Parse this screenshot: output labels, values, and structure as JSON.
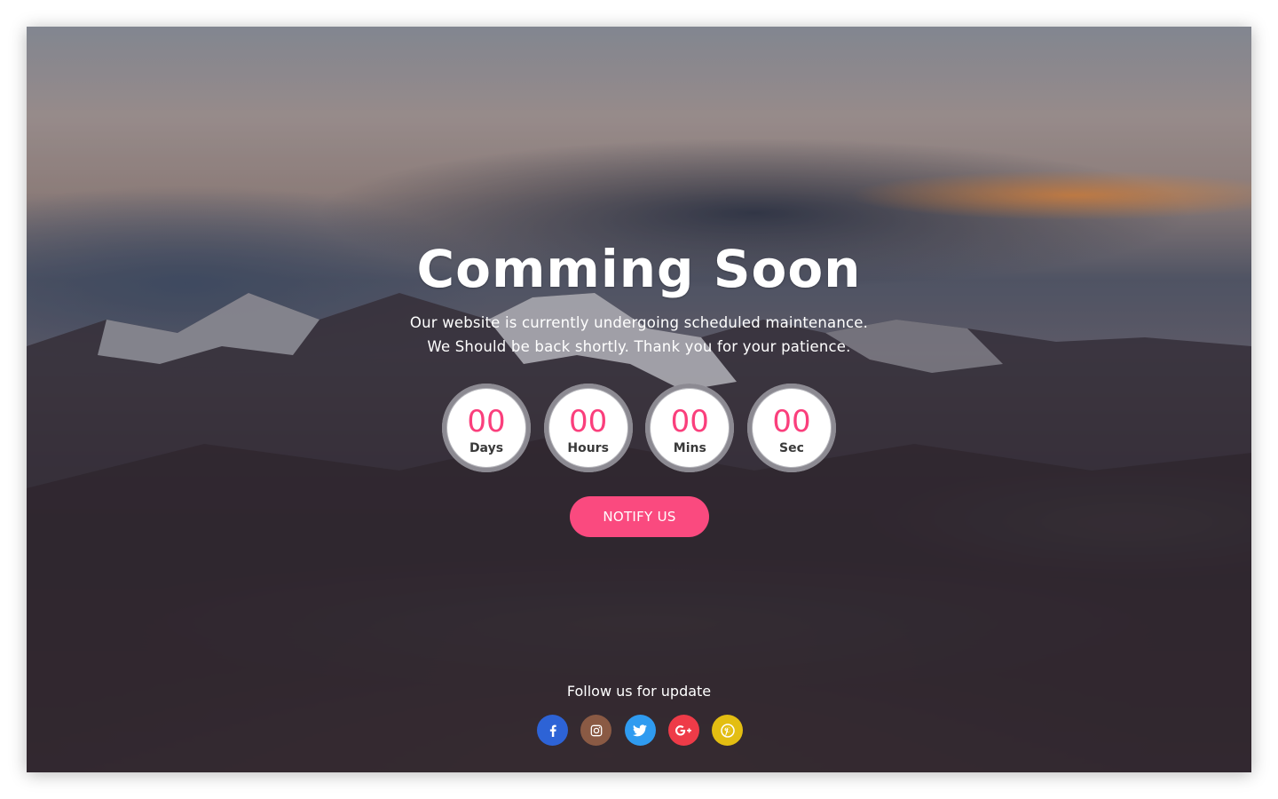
{
  "hero": {
    "title": "Comming Soon",
    "line1": "Our website is currently undergoing scheduled maintenance.",
    "line2": "We Should be back shortly. Thank you for your patience."
  },
  "countdown": [
    {
      "value": "00",
      "label": "Days"
    },
    {
      "value": "00",
      "label": "Hours"
    },
    {
      "value": "00",
      "label": "Mins"
    },
    {
      "value": "00",
      "label": "Sec"
    }
  ],
  "notify_button": "NOTIFY US",
  "follow_text": "Follow us for update",
  "social": [
    {
      "icon": "facebook-icon",
      "color": "#2d63d6"
    },
    {
      "icon": "instagram-icon",
      "color": "#8a5a44"
    },
    {
      "icon": "twitter-icon",
      "color": "#2f9bf0"
    },
    {
      "icon": "google-plus-icon",
      "color": "#ee3b48"
    },
    {
      "icon": "pinterest-icon",
      "color": "#e3be12"
    }
  ],
  "colors": {
    "accent": "#fa3f7c",
    "button": "#fa4a7f"
  }
}
